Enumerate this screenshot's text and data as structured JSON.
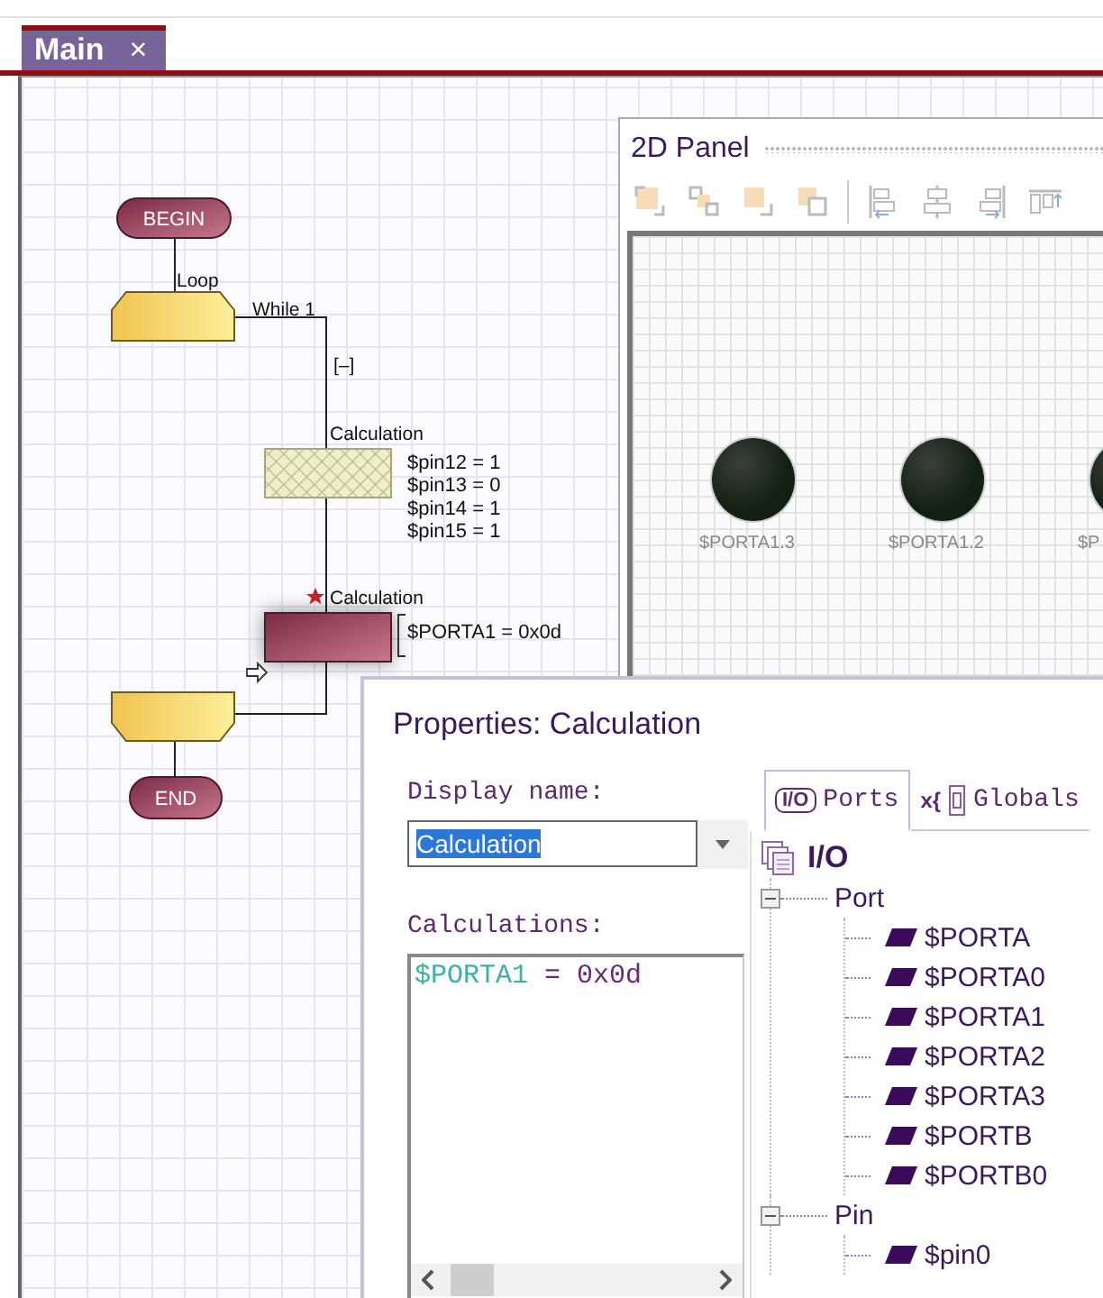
{
  "tabs": [
    {
      "label": "Main",
      "close": "×",
      "selected": true
    }
  ],
  "flowchart": {
    "begin": "BEGIN",
    "loop": {
      "label": "Loop",
      "condition": "While 1",
      "collapse": "[–]"
    },
    "calculations": [
      {
        "label": "Calculation",
        "lines": [
          "$pin12 = 1",
          "$pin13 = 0",
          "$pin14 = 1",
          "$pin15 = 1"
        ],
        "disabled": true,
        "selected": false
      },
      {
        "label": "Calculation",
        "lines": [
          "$PORTA1 = 0x0d"
        ],
        "disabled": false,
        "selected": true
      }
    ],
    "end": "END"
  },
  "panel_2d": {
    "title": "2D Panel",
    "leds": [
      {
        "label": "$PORTA1.3",
        "on": false
      },
      {
        "label": "$PORTA1.2",
        "on": false
      },
      {
        "label": "$P",
        "on": false
      }
    ]
  },
  "properties": {
    "title": "Properties: Calculation",
    "display_name": {
      "label": "Display name:",
      "value": "Calculation"
    },
    "calculations": {
      "label": "Calculations:",
      "variable": "$PORTA1",
      "expression": "= 0x0d"
    },
    "tabs": [
      {
        "badge": "I/O",
        "label": "Ports",
        "selected": true
      },
      {
        "badge": "x{",
        "label": "Globals",
        "selected": false
      }
    ],
    "tree": {
      "label": "I/O",
      "children": [
        {
          "label": "Port",
          "expanded": true,
          "children": [
            {
              "label": "$PORTA"
            },
            {
              "label": "$PORTA0"
            },
            {
              "label": "$PORTA1"
            },
            {
              "label": "$PORTA2"
            },
            {
              "label": "$PORTA3"
            },
            {
              "label": "$PORTB"
            },
            {
              "label": "$PORTB0"
            }
          ]
        },
        {
          "label": "Pin",
          "expanded": true,
          "children": [
            {
              "label": "$pin0"
            }
          ]
        }
      ]
    }
  }
}
